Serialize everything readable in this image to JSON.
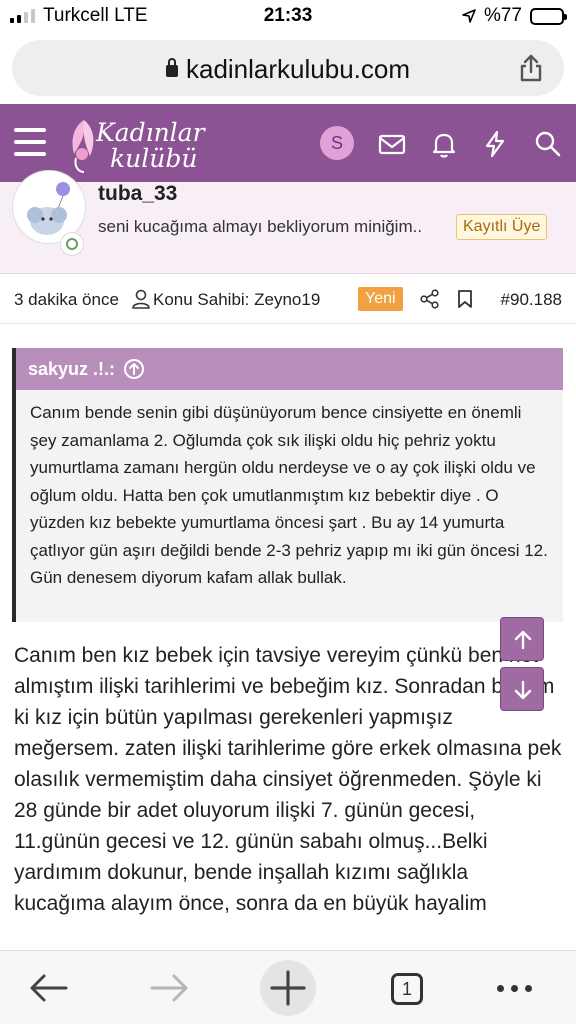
{
  "status_bar": {
    "carrier": "Turkcell LTE",
    "time": "21:33",
    "battery": "%77",
    "battery_level": 0.77
  },
  "browser": {
    "url": "kadinlarkulubu.com",
    "icons": {
      "lock": "lock-icon",
      "share": "share-icon"
    }
  },
  "site": {
    "logo_line1": "Kadınlar",
    "logo_line2": "kulübü",
    "avatar_letter": "S",
    "brand_color": "#8c5394",
    "icons": [
      "menu-icon",
      "mail-icon",
      "bell-icon",
      "bolt-icon",
      "search-icon"
    ]
  },
  "post": {
    "username": "tuba_33",
    "user_title": "seni kucağıma almayı bekliyorum miniğim..",
    "user_badge": "Kayıtlı Üye",
    "time_ago": "3 dakika önce",
    "thread_owner": "Konu Sahibi: Zeyno19",
    "new_badge": "Yeni",
    "post_number": "#90.188",
    "quote": {
      "author": "sakyuz .!.:",
      "text": "Canım bende senin gibi düşünüyorum bence cinsiyette en önemli şey zamanlama 2. Oğlumda çok sık ilişki oldu hiç pehriz yoktu yumurtlama zamanı hergün oldu nerdeyse ve o ay çok ilişki oldu ve oğlum oldu. Hatta ben çok umutlanmıştım kız bebektir diye . O yüzden kız bebekte yumurtlama öncesi şart . Bu ay 14 yumurta çatlıyor gün aşırı değildi bende 2-3 pehriz yapıp mı iki gün öncesi 12. Gün denesem diyorum kafam allak bullak."
    },
    "message": "Canım ben kız bebek için tavsiye vereyim çünkü ben not almıştım ilişki tarihlerimi ve bebeğim kız. Sonradan baktım ki kız için bütün yapılması gerekenleri yapmışız meğersem. zaten ilişki tarihlerime göre erkek olmasına pek olasılık vermemiştim daha cinsiyet öğrenmeden. Şöyle ki 28 günde bir adet oluyorum ilişki 7. günün gecesi, 11.günün gecesi ve 12. günün sabahı olmuş...Belki yardımım dokunur, bende inşallah kızımı sağlıkla kucağıma alayım önce, sonra da en büyük hayalim"
  },
  "toolbar": {
    "tab_count": "1",
    "icons": [
      "back-icon",
      "forward-icon",
      "plus-icon",
      "tabs-icon",
      "more-icon"
    ]
  }
}
